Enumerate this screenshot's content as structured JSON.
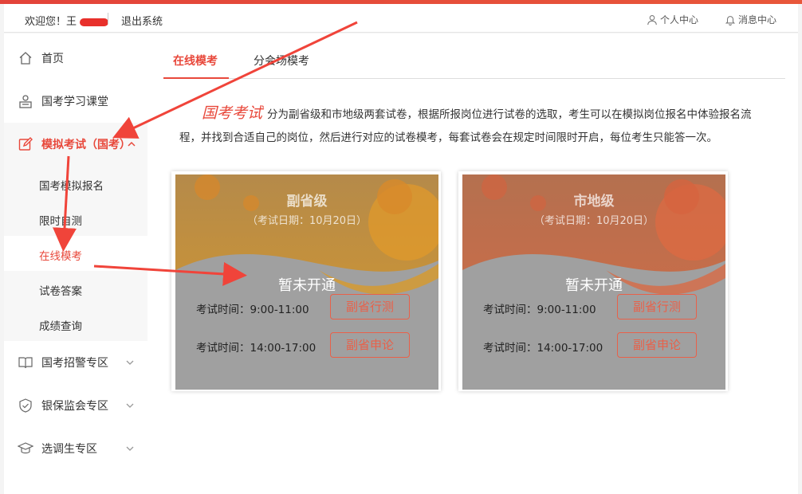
{
  "topbar": {
    "welcome": "欢迎您！王",
    "logout": "退出系统",
    "personal_center": "个人中心",
    "message_center": "消息中心"
  },
  "sidebar": {
    "items": [
      {
        "label": "首页",
        "icon": "home-icon"
      },
      {
        "label": "国考学习课堂",
        "icon": "teacher-icon"
      },
      {
        "label": "模拟考试（国考）",
        "icon": "edit-icon",
        "active": true
      },
      {
        "label": "国考招警专区",
        "icon": "book-icon"
      },
      {
        "label": "银保监会专区",
        "icon": "shield-icon"
      },
      {
        "label": "选调生专区",
        "icon": "graduation-cap-icon"
      }
    ],
    "subitems": [
      {
        "label": "国考模拟报名"
      },
      {
        "label": "限时自测"
      },
      {
        "label": "在线模考",
        "current": true
      },
      {
        "label": "试卷答案"
      },
      {
        "label": "成绩查询"
      }
    ]
  },
  "tabs": [
    {
      "label": "在线模考",
      "active": true
    },
    {
      "label": "分会场模考"
    }
  ],
  "intro": {
    "heading": "国考考试",
    "text": "分为副省级和市地级两套试卷，根据所报岗位进行试卷的选取，考生可以在模拟岗位报名中体验报名流程，并找到合适自己的岗位，然后进行对应的试卷模考，每套试卷会在规定时间限时开启，每位考生只能答一次。"
  },
  "cards": [
    {
      "title": "副省级",
      "date": "（考试日期：10月20日）",
      "status": "暂未开通",
      "sessions": [
        {
          "time": "考试时间：9:00-11:00",
          "button": "副省行测"
        },
        {
          "time": "考试时间：14:00-17:00",
          "button": "副省申论"
        }
      ],
      "color": "#e9a52a"
    },
    {
      "title": "市地级",
      "date": "（考试日期：10月20日）",
      "status": "暂未开通",
      "sessions": [
        {
          "time": "考试时间：9:00-11:00",
          "button": "副省行测"
        },
        {
          "time": "考试时间：14:00-17:00",
          "button": "副省申论"
        }
      ],
      "color": "#e56a45"
    }
  ],
  "colors": {
    "accent": "#e8483b",
    "annotation_arrow": "#f0443a"
  }
}
